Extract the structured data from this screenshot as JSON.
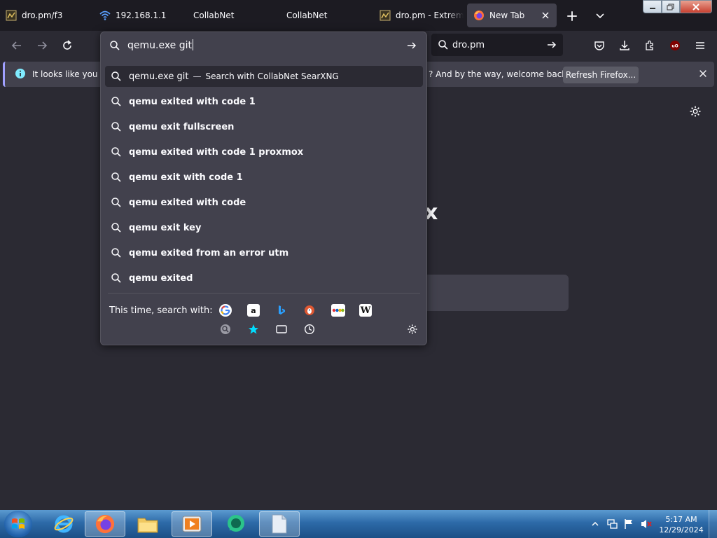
{
  "tabs": [
    {
      "label": "dro.pm/f3",
      "active": false
    },
    {
      "label": "192.168.1.1",
      "active": false
    },
    {
      "label": "CollabNet",
      "active": false
    },
    {
      "label": "CollabNet",
      "active": false
    },
    {
      "label": "dro.pm - Extrem",
      "active": false
    },
    {
      "label": "New Tab",
      "active": true
    }
  ],
  "urlbar": {
    "value": "qemu.exe git"
  },
  "searchbar": {
    "value": "dro.pm"
  },
  "notification": {
    "text_left": "It looks like you ha",
    "text_right": "? And by the way, welcome back!",
    "button": "Refresh Firefox..."
  },
  "dropdown": {
    "first": {
      "query": "qemu.exe git",
      "separator": "—",
      "action": "Search with CollabNet SearXNG"
    },
    "suggestions": [
      "qemu exited with code 1",
      "qemu exit fullscreen",
      "qemu exited with code 1 proxmox",
      "qemu exit with code 1",
      "qemu exited with code",
      "qemu exit key",
      "qemu exited from an error utm",
      "qemu exited"
    ],
    "search_with_label": "This time, search with:",
    "engines": [
      "google-icon",
      "amazon-icon",
      "bing-icon",
      "duckduckgo-icon",
      "ebay-icon",
      "wikipedia-icon",
      "searxng-icon",
      "bookmarks-icon",
      "tabs-icon",
      "history-icon"
    ]
  },
  "content": {
    "partial_text": "x"
  },
  "taskbar": {
    "time": "5:17 AM",
    "date": "12/29/2024"
  }
}
